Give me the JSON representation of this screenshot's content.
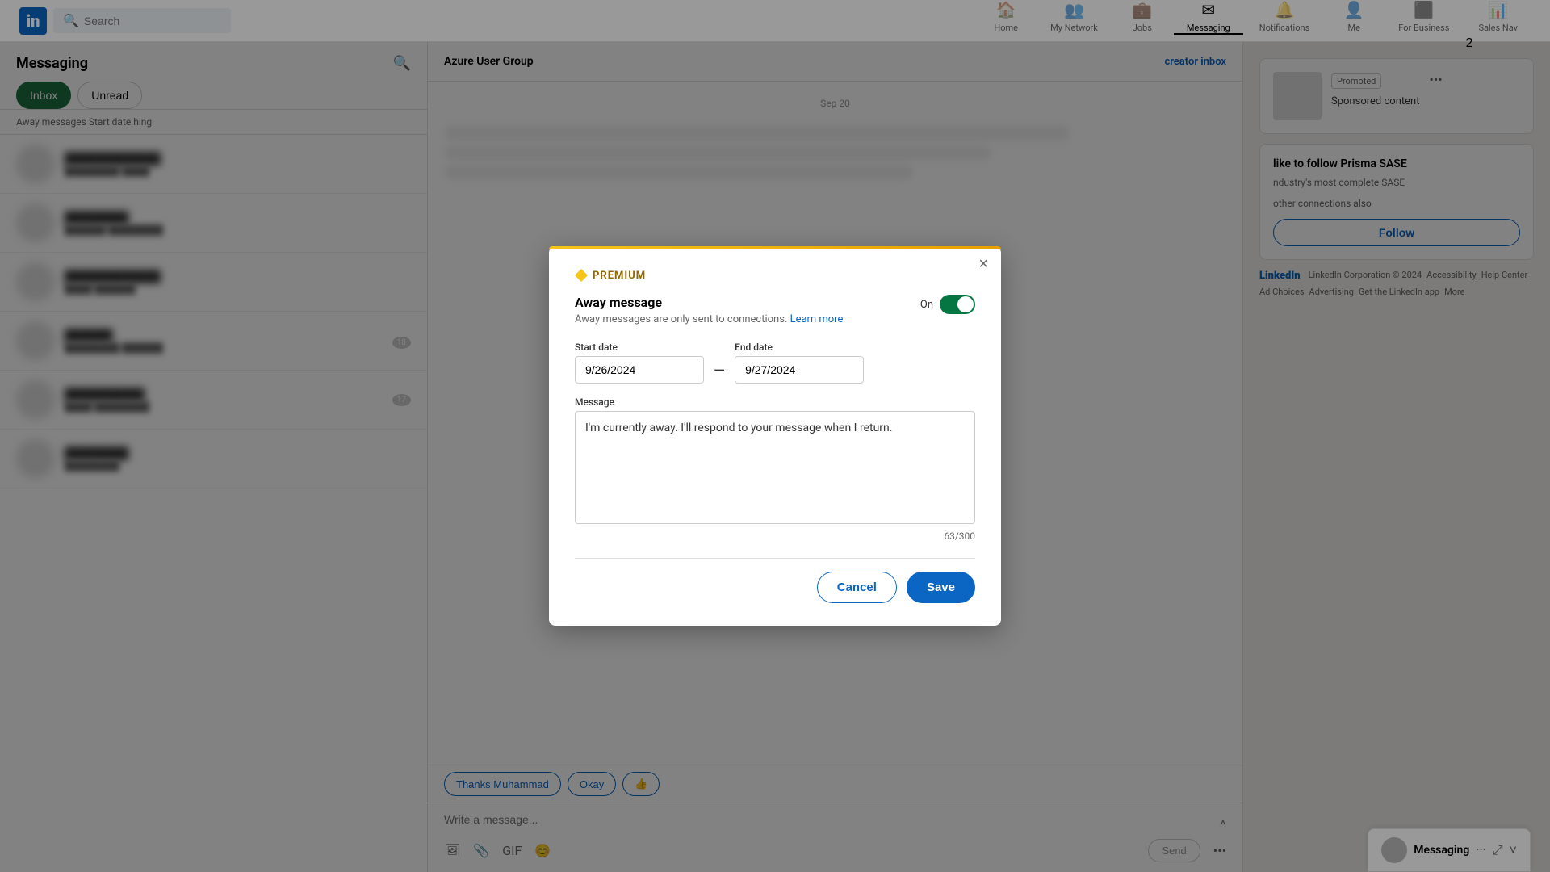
{
  "navbar": {
    "logo_text": "in",
    "search_placeholder": "Search",
    "items": [
      {
        "label": "Home",
        "icon": "🏠",
        "active": false,
        "key": "home"
      },
      {
        "label": "My Network",
        "icon": "👥",
        "active": false,
        "key": "network"
      },
      {
        "label": "Jobs",
        "icon": "💼",
        "active": false,
        "key": "jobs"
      },
      {
        "label": "Messaging",
        "icon": "✉",
        "active": true,
        "key": "messaging"
      },
      {
        "label": "Notifications",
        "icon": "🔔",
        "active": false,
        "key": "notifications"
      },
      {
        "label": "Me",
        "icon": "👤",
        "active": false,
        "key": "me"
      },
      {
        "label": "For Business",
        "icon": "⬛",
        "active": false,
        "key": "business"
      },
      {
        "label": "Sales Nav",
        "icon": "📊",
        "active": false,
        "badge": "2",
        "key": "sales"
      }
    ]
  },
  "messaging": {
    "title": "Messaging",
    "search_placeholder": "Search messages",
    "tabs": [
      {
        "label": "Inbox",
        "active": true
      },
      {
        "label": "Unread",
        "active": false
      }
    ],
    "away_settings_label": "Away messages  Start date  hing"
  },
  "conversation": {
    "header_title": "Azure User Group",
    "creator_inbox_label": "creator inbox",
    "date_label": "Sep 20",
    "quick_replies": [
      {
        "label": "Thanks Muhammad"
      },
      {
        "label": "Okay"
      },
      {
        "label": "👍"
      }
    ],
    "compose_placeholder": "Write a message...",
    "compose_tools": [
      "image",
      "attachment",
      "gif",
      "emoji"
    ],
    "send_label": "Send"
  },
  "right_panel": {
    "promoted_badge": "Promoted",
    "follow_card": {
      "title": "like to follow Prisma SASE",
      "subtitle": "ndustry's most complete SASE",
      "subtitle2": "other connections also",
      "follow_label": "Follow"
    },
    "footer_links": [
      "Accessibility",
      "Help Center",
      "Ad Choices",
      "Advertising",
      "Get the LinkedIn app",
      "More"
    ],
    "footer_copyright": "LinkedIn Corporation © 2024"
  },
  "modal": {
    "premium_label": "PREMIUM",
    "close_label": "×",
    "title": "Away message",
    "subtitle": "Away messages are only sent to connections.",
    "learn_more_label": "Learn more",
    "toggle_label": "On",
    "toggle_on": true,
    "start_date_label": "Start date",
    "start_date_value": "9/26/2024",
    "end_date_label": "End date",
    "end_date_value": "9/27/2024",
    "message_label": "Message",
    "message_value": "I'm currently away. I'll respond to your message when I return.",
    "char_count": "63/300",
    "cancel_label": "Cancel",
    "save_label": "Save"
  },
  "bottom_bar": {
    "title": "Messaging",
    "dots_label": "···",
    "expand_label": "⤢",
    "collapse_label": "˅"
  }
}
